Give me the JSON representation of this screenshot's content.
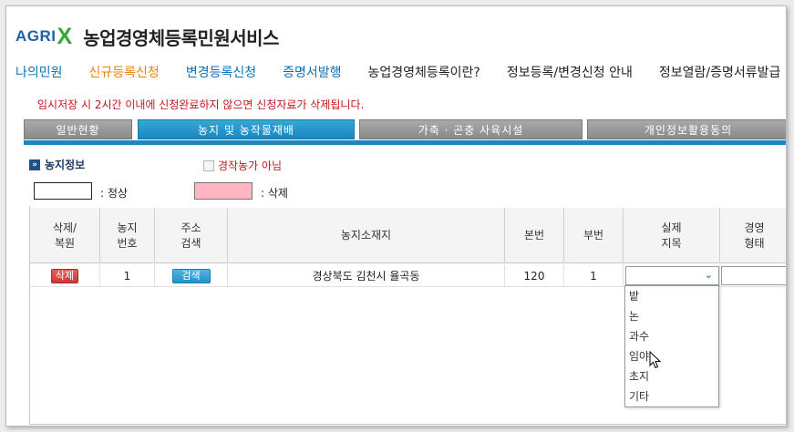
{
  "logo": {
    "agri": "AGRI",
    "x": "X"
  },
  "site_title": "농업경영체등록민원서비스",
  "nav": [
    {
      "label": "나의민원",
      "color": "#0b72b8"
    },
    {
      "label": "신규등록신청",
      "color": "#e8860c"
    },
    {
      "label": "변경등록신청",
      "color": "#0b72b8"
    },
    {
      "label": "증명서발행",
      "color": "#0b72b8"
    },
    {
      "label": "농업경영체등록이란?",
      "color": "#222222"
    },
    {
      "label": "정보등록/변경신청 안내",
      "color": "#222222"
    },
    {
      "label": "정보열람/증명서류발급",
      "color": "#222222"
    }
  ],
  "warning": "임시저장 시 2시간 이내에 신청완료하지 않으면 신청자료가 삭제됩니다.",
  "tabs": [
    {
      "label": "일반현황",
      "active": false
    },
    {
      "label": "농지 및 농작물재배",
      "active": true
    },
    {
      "label": "가축 · 곤충 사육시설",
      "active": false
    },
    {
      "label": "개인정보활용동의",
      "active": false
    }
  ],
  "section": {
    "icon": "arrow-right-icon",
    "title": "농지정보"
  },
  "checkbox": {
    "label": "경작농가 아님",
    "checked": false
  },
  "legend": [
    {
      "label": ": 정상",
      "color": "#ffffff"
    },
    {
      "label": ": 삭제",
      "color": "#ffb6c1"
    }
  ],
  "table": {
    "headers": [
      "삭제/\n복원",
      "농지\n번호",
      "주소\n검색",
      "농지소재지",
      "본번",
      "부번",
      "실제\n지목",
      "경영\n형태"
    ],
    "row": {
      "delete_label": "삭제",
      "number": "1",
      "search_label": "검색",
      "location": "경상북도 김천시 율곡동",
      "main_no": "120",
      "sub_no": "1",
      "land_type_value": "",
      "mgmt_value": ""
    }
  },
  "dropdown_options": [
    "밭",
    "논",
    "과수",
    "임야",
    "초지",
    "기타"
  ]
}
